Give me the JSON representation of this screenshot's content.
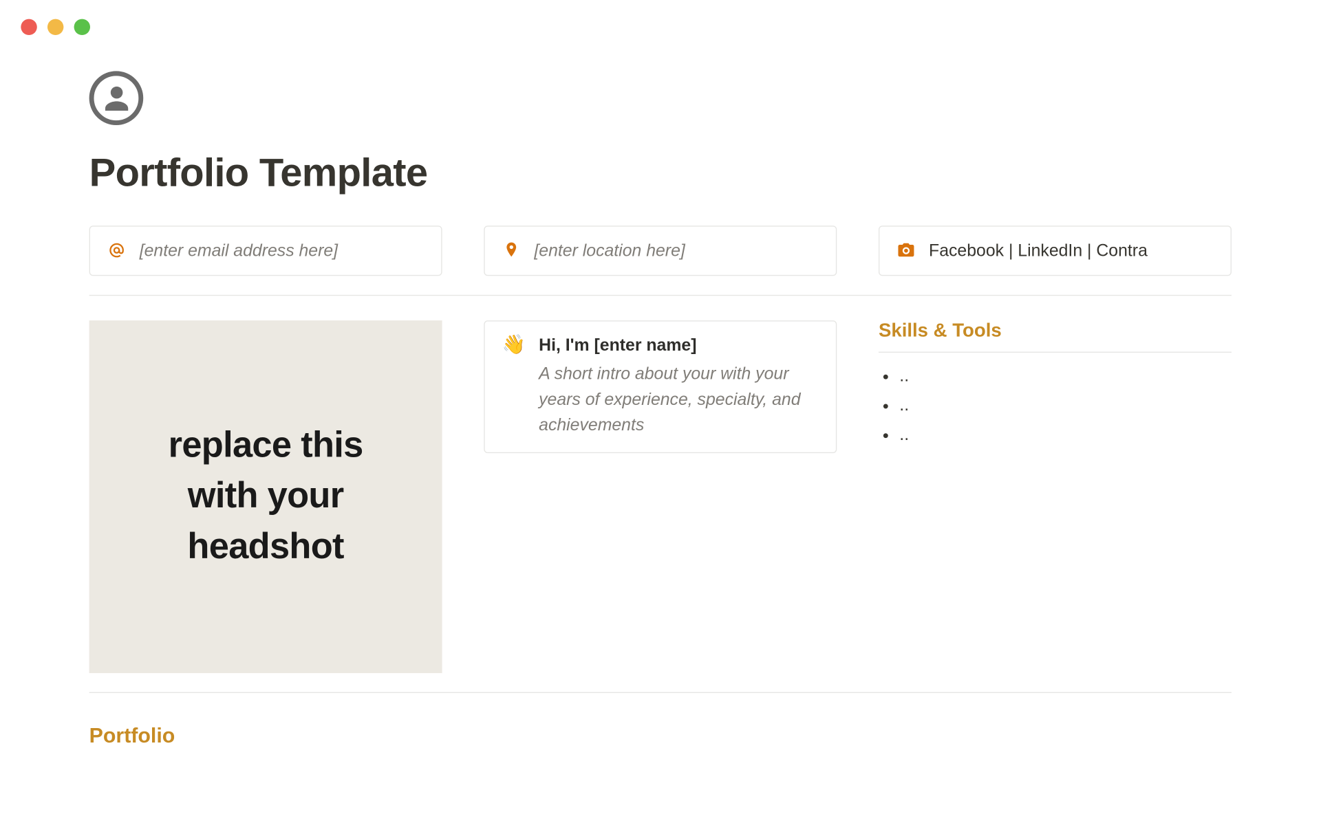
{
  "page": {
    "title": "Portfolio Template"
  },
  "contact": {
    "email_placeholder": "[enter email address here]",
    "location_placeholder": "[enter location here]",
    "social_text": "Facebook | LinkedIn | Contra"
  },
  "headshot": {
    "placeholder_text": "replace this with your headshot"
  },
  "intro": {
    "emoji": "👋",
    "name_line": "Hi, I'm [enter name]",
    "sub": "A short intro about your with your years of experience, specialty, and achievements"
  },
  "skills": {
    "heading": "Skills & Tools",
    "items": [
      "..",
      "..",
      ".."
    ]
  },
  "sections": {
    "portfolio_heading": "Portfolio"
  },
  "icons": {
    "at": "at-icon",
    "pin": "location-pin-icon",
    "camera": "camera-icon"
  }
}
